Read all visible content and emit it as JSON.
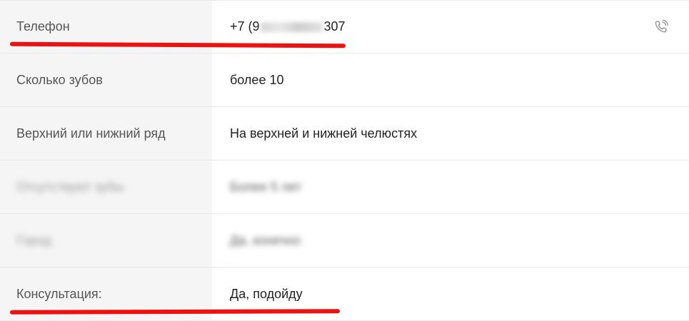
{
  "rows": [
    {
      "label": "Телефон",
      "phone_prefix": "+7 (9",
      "phone_suffix": "307",
      "call_icon": "phone-call-icon"
    },
    {
      "label": "Сколько зубов",
      "value": "более 10"
    },
    {
      "label": "Верхний или нижний ряд",
      "value": "На верхней и нижней челюстях"
    },
    {
      "label": "Отсутствуют зубы",
      "value": "Более 5 лет",
      "blurred": true
    },
    {
      "label": "Город",
      "value": "Да, конечно",
      "blurred": true
    },
    {
      "label": "Консультация:",
      "value": "Да, подойду"
    }
  ],
  "colors": {
    "label_bg": "#f5f5f5",
    "label_text": "#555555",
    "value_text": "#222222",
    "annotation": "#ee1111"
  }
}
